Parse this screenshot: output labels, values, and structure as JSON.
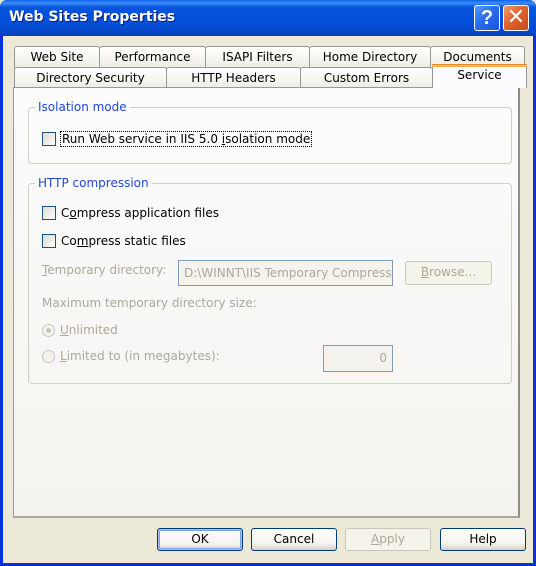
{
  "window": {
    "title": "Web Sites Properties",
    "help_button": "?",
    "close_button": "✕"
  },
  "tabs": {
    "row_back": [
      {
        "label": "Web Site"
      },
      {
        "label": "Performance"
      },
      {
        "label": "ISAPI Filters"
      },
      {
        "label": "Home Directory"
      },
      {
        "label": "Documents"
      }
    ],
    "row_front": [
      {
        "label": "Directory Security"
      },
      {
        "label": "HTTP Headers"
      },
      {
        "label": "Custom Errors"
      },
      {
        "label": "Service",
        "active": true
      }
    ]
  },
  "isolation": {
    "legend": "Isolation mode",
    "run_iis5": {
      "label_pre": "Run Web service in IIS 5.0 ",
      "label_accel": "i",
      "label_post": "solation mode",
      "checked": false
    }
  },
  "compression": {
    "legend": "HTTP compression",
    "app_files": {
      "label_pre": "C",
      "label_accel": "o",
      "label_post": "mpress application files",
      "checked": false
    },
    "static_files": {
      "label_pre": "Co",
      "label_accel": "m",
      "label_post": "press static files",
      "checked": false
    },
    "temp_dir": {
      "label_accel": "T",
      "label_post": "emporary directory:",
      "value": "D:\\WINNT\\IIS Temporary Compressed Files"
    },
    "browse": {
      "label_accel": "B",
      "label_post": "rowse..."
    },
    "max_size_label": "Maximum temporary directory size:",
    "unlimited": {
      "label_accel": "U",
      "label_post": "nlimited",
      "selected": true
    },
    "limited": {
      "label_accel": "L",
      "label_post": "imited to (in megabytes):",
      "selected": false,
      "value": "0"
    }
  },
  "buttons": {
    "ok": "OK",
    "cancel": "Cancel",
    "apply_accel": "A",
    "apply_post": "pply",
    "help": "Help"
  }
}
